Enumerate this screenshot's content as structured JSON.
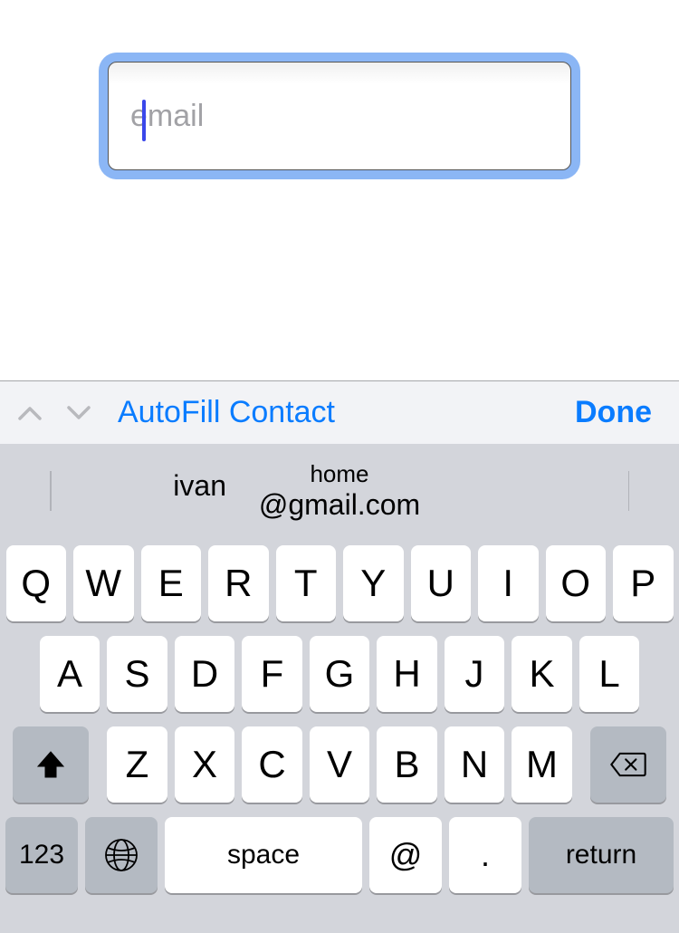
{
  "input": {
    "placeholder": "email",
    "value": ""
  },
  "toolbar": {
    "autofill_label": "AutoFill Contact",
    "done_label": "Done"
  },
  "suggestions": {
    "left": "ivan",
    "center_top": "home",
    "center_bottom": "@gmail.com"
  },
  "keyboard": {
    "row1": [
      "Q",
      "W",
      "E",
      "R",
      "T",
      "Y",
      "U",
      "I",
      "O",
      "P"
    ],
    "row2": [
      "A",
      "S",
      "D",
      "F",
      "G",
      "H",
      "J",
      "K",
      "L"
    ],
    "row3": [
      "Z",
      "X",
      "C",
      "V",
      "B",
      "N",
      "M"
    ],
    "key_123": "123",
    "key_space": "space",
    "key_at": "@",
    "key_dot": ".",
    "key_return": "return"
  }
}
